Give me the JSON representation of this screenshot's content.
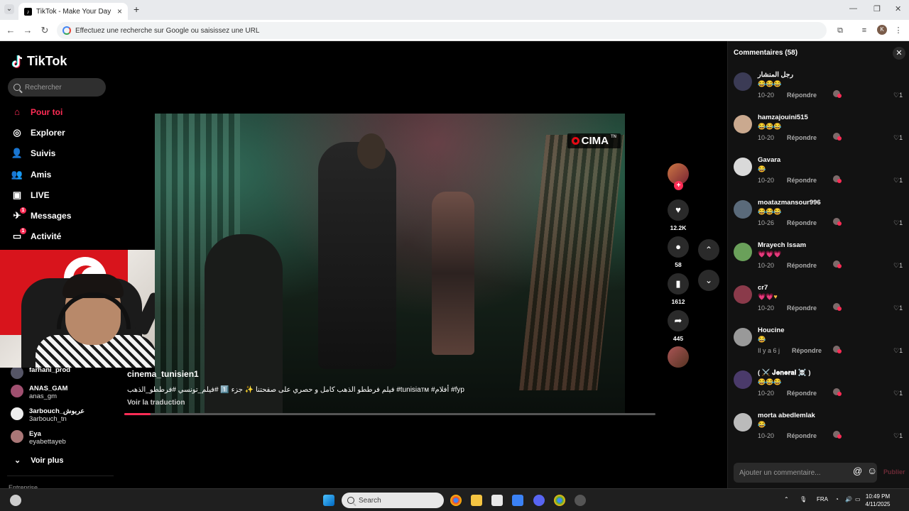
{
  "browser": {
    "tab_title": "TikTok - Make Your Day",
    "omnibox_placeholder": "Effectuez une recherche sur Google ou saisissez une URL",
    "profile_initial": "K"
  },
  "sidebar": {
    "logo": "TikTok",
    "search_placeholder": "Rechercher",
    "nav": [
      {
        "label": "Pour toi",
        "icon": "home-icon",
        "active": true
      },
      {
        "label": "Explorer",
        "icon": "compass-icon"
      },
      {
        "label": "Suivis",
        "icon": "following-icon"
      },
      {
        "label": "Amis",
        "icon": "friends-icon"
      },
      {
        "label": "LIVE",
        "icon": "live-icon"
      },
      {
        "label": "Messages",
        "icon": "messages-icon",
        "badge": "1"
      },
      {
        "label": "Activité",
        "icon": "activity-icon",
        "badge": "1"
      }
    ],
    "following": [
      {
        "name": "farhani_prod",
        "username": ""
      },
      {
        "name": "ANAS_GAM",
        "username": "anas_gm"
      },
      {
        "name": "3arbouch_عربوش",
        "username": "3arbouch_tn"
      },
      {
        "name": "Eya",
        "username": "eyabettayeb"
      }
    ],
    "see_more": "Voir plus",
    "footer_label": "Entreprise"
  },
  "video": {
    "watermark": "CIMA",
    "author": "cinema_tunisien1",
    "caption": "فيلم فرططو الذهب كامل و حصري على صفحتنا ✨ جزء 1️⃣ #فيلم_تونسي #فرططو_الذهب #tunisiaтм #أفلام #fyp",
    "translate": "Voir la traduction",
    "progress": 0.05
  },
  "actions": {
    "likes": "12.2K",
    "comments": "58",
    "saves": "1612",
    "shares": "445"
  },
  "comments_panel": {
    "title": "Commentaires (58)",
    "reply_label": "Répondre",
    "input_placeholder": "Ajouter un commentaire...",
    "post_label": "Publier",
    "items": [
      {
        "user": "رجل المنشار",
        "text": "😂😂😂",
        "date": "10-20",
        "likes": "1",
        "color": "#3b3b55"
      },
      {
        "user": "hamzajouini515",
        "text": "😂😂😂",
        "date": "10-20",
        "likes": "1",
        "color": "#caa98f"
      },
      {
        "user": "Gavara",
        "text": "😂",
        "date": "10-20",
        "likes": "1",
        "color": "#d9d9d9"
      },
      {
        "user": "moatazmansour996",
        "text": "😂😂😂",
        "date": "10-26",
        "likes": "1",
        "color": "#5a6a7a"
      },
      {
        "user": "Mrayech Issam",
        "text": "💗💗💗",
        "date": "10-20",
        "likes": "1",
        "color": "#6aa05a"
      },
      {
        "user": "cr7",
        "text": "💗💗♥",
        "date": "10-20",
        "likes": "1",
        "color": "#8a3a4a"
      },
      {
        "user": "Houcine",
        "text": "😂",
        "date": "Il y a 6 j",
        "likes": "1",
        "color": "#999999"
      },
      {
        "user": "( ⚔️ 𝐉𝐞𝐧𝐞𝐫𝐚𝐥 ☠️ )",
        "text": "😂😂😂",
        "date": "10-20",
        "likes": "1",
        "color": "#4a3a6a"
      },
      {
        "user": "morta abedlemlak",
        "text": "😂",
        "date": "10-20",
        "likes": "1",
        "color": "#bbbbbb"
      }
    ]
  },
  "taskbar": {
    "search_label": "Search",
    "language": "FRA",
    "time": "10:49 PM",
    "date": "4/11/2025"
  }
}
